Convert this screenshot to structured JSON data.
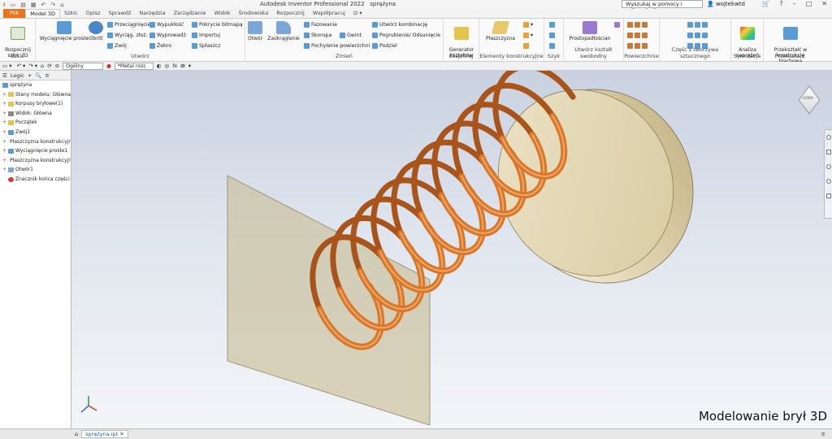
{
  "window": {
    "title": "Autodesk Inventor Professional 2022",
    "document_name": "sprężyna",
    "search_placeholder": "Wyszukaj w pomocy i poleceniach",
    "user": "wojtekwtd"
  },
  "tabs": [
    {
      "label": "Plik"
    },
    {
      "label": "Model 3D"
    },
    {
      "label": "Szkic"
    },
    {
      "label": "Opisz"
    },
    {
      "label": "Sprawdź"
    },
    {
      "label": "Narzędzia"
    },
    {
      "label": "Zarządzanie"
    },
    {
      "label": "Widok"
    },
    {
      "label": "Środowiska"
    },
    {
      "label": "Rozpocznij"
    },
    {
      "label": "Współpracuj"
    }
  ],
  "ribbon": {
    "sketch_panel": {
      "label": "Szkic",
      "start_2d": "Rozpocznij\nszkic 2D"
    },
    "create_panel": {
      "label": "Utwórz",
      "extrude": "Wyciągnięcie proste",
      "revolve": "Obrót",
      "sweep": "Przeciągnięcie",
      "loft": "Wyciąg. złoż.",
      "coil": "Zwój",
      "emboss": "Wypukłość",
      "derive": "Wyprowadź",
      "rib": "Żebro",
      "decal": "Pokrycie bitmapą",
      "import": "Importuj",
      "unwrap": "Spłaszcz"
    },
    "modify_panel": {
      "label": "Zmień",
      "hole": "Otwór",
      "fillet": "Zaokrąglenie",
      "chamfer": "Fazowanie",
      "shell": "Skorupa",
      "draft": "Pochylenie powierzchni",
      "thread": "Gwint",
      "combine": "Utwórz kombinację",
      "thicken": "Pogrubienie/ Odsunięcie",
      "split": "Podziel"
    },
    "explore_panel": {
      "label": "Eksploruj",
      "generator": "Generator\nkształtów"
    },
    "work_features_panel": {
      "label": "Elementy konstrukcyjne",
      "plane": "Płaszczyzna"
    },
    "pattern_panel": {
      "label": "Szyk"
    },
    "freeform_panel": {
      "label": "Utwórz kształt swobodny",
      "box": "Prostopadłościan"
    },
    "surface_panel": {
      "label": "Powierzchnie"
    },
    "plastic_panel": {
      "label": "Część z tworzywa sztucznego"
    },
    "simulation_panel": {
      "label": "Symulacja",
      "stress": "Analiza\nnaprężeń"
    },
    "convert_panel": {
      "label": "Przekształć",
      "sheetmetal": "Przekształć w\nkonstrukcję blachową"
    }
  },
  "toolbar2": {
    "style": "Ogólny",
    "material": "*Metal rozc"
  },
  "browser": {
    "mode": "Logic",
    "items": [
      {
        "label": "sprężyna",
        "level": 0,
        "icon": "part-icon"
      },
      {
        "label": "Stany modelu: Główna",
        "level": 1,
        "icon": "folder-icon"
      },
      {
        "label": "Korpusy bryłowe(1)",
        "level": 1,
        "icon": "folder-icon"
      },
      {
        "label": "Widok: Główna",
        "level": 1,
        "icon": "view-icon"
      },
      {
        "label": "Początek",
        "level": 1,
        "icon": "folder-icon"
      },
      {
        "label": "Zwój1",
        "level": 1,
        "icon": "coil-icon"
      },
      {
        "label": "Płaszczyzna konstrukcyjna1",
        "level": 1,
        "icon": "plane-icon"
      },
      {
        "label": "Wyciągnięcie proste1",
        "level": 1,
        "icon": "extrude-icon"
      },
      {
        "label": "Płaszczyzna konstrukcyjna2",
        "level": 1,
        "icon": "plane-icon"
      },
      {
        "label": "Otwór1",
        "level": 1,
        "icon": "hole-icon"
      },
      {
        "label": "Znacznik końca części",
        "level": 1,
        "icon": "end-of-part-icon"
      }
    ]
  },
  "viewcube": {
    "label": "GÓRA"
  },
  "watermark": "Modelowanie brył 3D",
  "status": {
    "doc_tab": "sprężyna.ipt"
  },
  "colors": {
    "file_tab": "#e8741e",
    "spring": "#d9772a",
    "disk": "#e7dcbc",
    "plane": "#c8bd94"
  }
}
